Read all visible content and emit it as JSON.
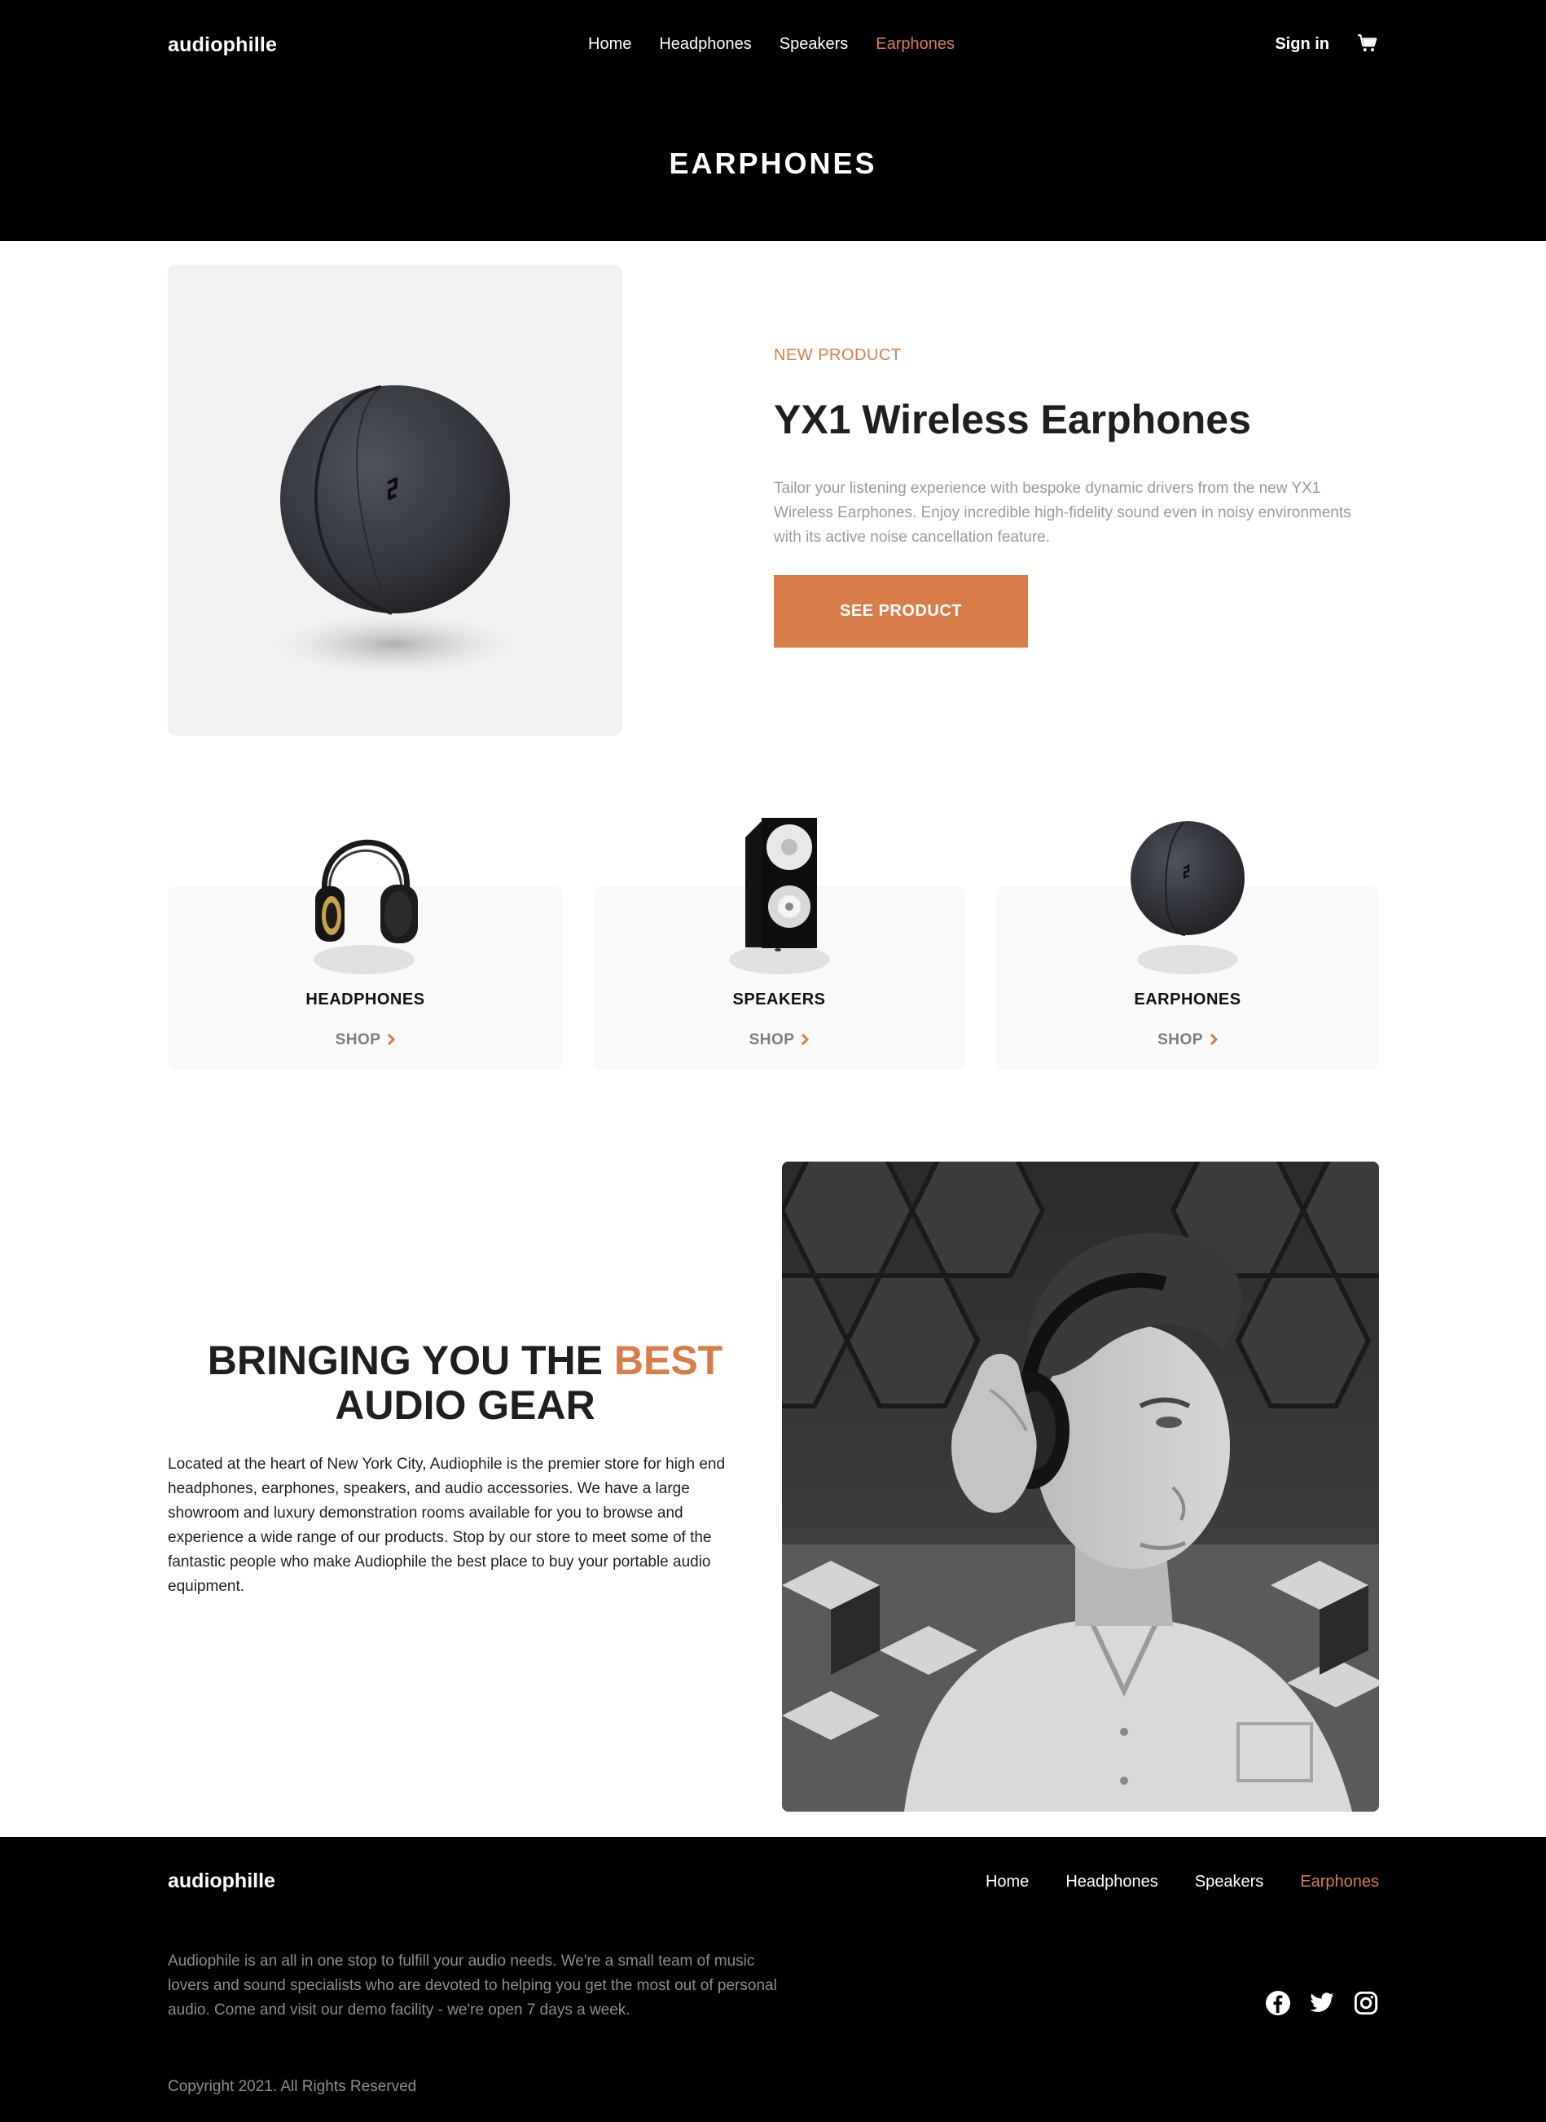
{
  "header": {
    "logo": "audiophille",
    "nav": [
      "Home",
      "Headphones",
      "Speakers",
      "Earphones"
    ],
    "active_nav": "Earphones",
    "signin": "Sign in",
    "cart_icon": "cart-icon",
    "page_title": "EARPHONES"
  },
  "featured": {
    "label": "NEW PRODUCT",
    "title": "YX1 Wireless Earphones",
    "description": "Tailor your listening experience with bespoke dynamic drivers from the new YX1 Wireless Earphones. Enjoy incredible high-fidelity sound even in noisy environments with its active noise cancellation feature.",
    "button": "SEE PRODUCT"
  },
  "categories": [
    {
      "name": "HEADPHONES",
      "shop": "SHOP"
    },
    {
      "name": "SPEAKERS",
      "shop": "SHOP"
    },
    {
      "name": "EARPHONES",
      "shop": "SHOP"
    }
  ],
  "about": {
    "heading_pre": "BRINGING YOU THE ",
    "heading_accent": "BEST",
    "heading_post": "AUDIO GEAR",
    "body": "Located at the heart of New York City, Audiophile is the premier store for high end headphones, earphones, speakers, and audio accessories. We have a large showroom and luxury demonstration rooms available for you to browse and experience a wide range of our products. Stop by our store to meet some of the fantastic people who make Audiophile the best place to buy your portable audio equipment."
  },
  "footer": {
    "logo": "audiophille",
    "nav": [
      "Home",
      "Headphones",
      "Speakers",
      "Earphones"
    ],
    "description": "Audiophile is an all in one stop to fulfill your audio needs. We're a small team of music lovers and sound specialists who are devoted to helping you get the most out of personal audio. Come and visit our demo facility - we're open 7 days a week.",
    "copyright": "Copyright 2021. All Rights Reserved",
    "social": [
      "facebook-icon",
      "twitter-icon",
      "instagram-icon"
    ]
  },
  "colors": {
    "accent": "#d87d4a",
    "dark": "#000000",
    "card": "#f9f9f9",
    "muted": "#8c8c8c"
  }
}
